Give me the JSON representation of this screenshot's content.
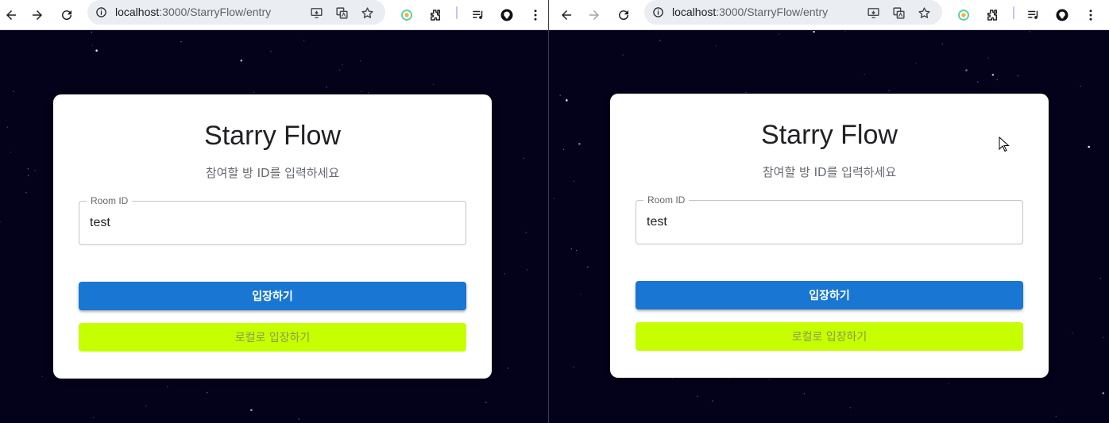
{
  "browser": {
    "url_host": "localhost",
    "url_path": ":3000/StarryFlow/entry"
  },
  "app": {
    "title": "Starry Flow",
    "subtitle": "참여할 방 ID를 입력하세요",
    "room_field": {
      "label": "Room ID",
      "value": "test"
    },
    "enter_button": "입장하기",
    "local_enter_button": "로컬로 입장하기"
  },
  "colors": {
    "background": "#04021a",
    "primary_button": "#1976d2",
    "local_button": "#c6ff00"
  }
}
